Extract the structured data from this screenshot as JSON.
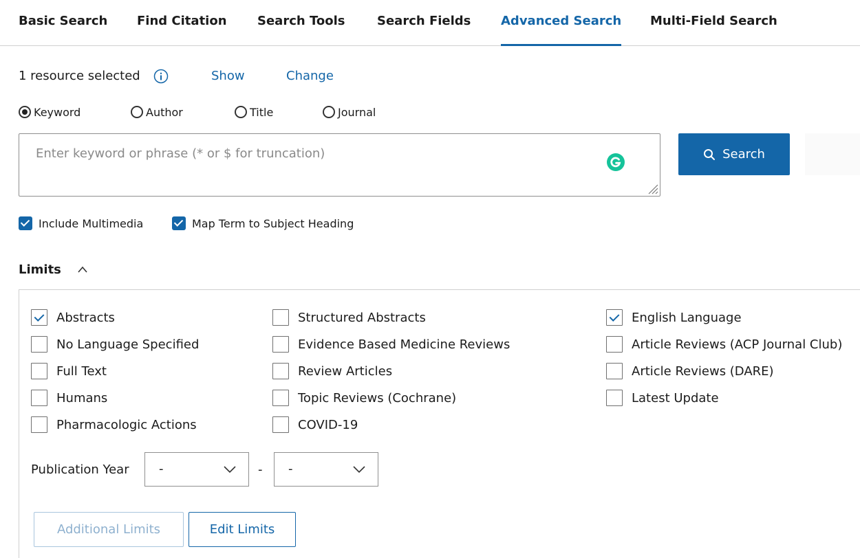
{
  "tabs": [
    {
      "label": "Basic Search",
      "active": false
    },
    {
      "label": "Find Citation",
      "active": false
    },
    {
      "label": "Search Tools",
      "active": false
    },
    {
      "label": "Search Fields",
      "active": false
    },
    {
      "label": "Advanced Search",
      "active": true
    },
    {
      "label": "Multi-Field Search",
      "active": false
    }
  ],
  "resources": {
    "selected_text": "1 resource selected",
    "show_link": "Show",
    "change_link": "Change"
  },
  "search_type": {
    "options": [
      "Keyword",
      "Author",
      "Title",
      "Journal"
    ],
    "selected": "Keyword"
  },
  "search": {
    "placeholder": "Enter keyword or phrase (* or $ for truncation)",
    "value": "",
    "button_label": "Search"
  },
  "options": {
    "include_multimedia": {
      "label": "Include Multimedia",
      "checked": true
    },
    "map_term": {
      "label": "Map Term to Subject Heading",
      "checked": true
    }
  },
  "limits": {
    "heading": "Limits",
    "columns": [
      [
        {
          "label": "Abstracts",
          "checked": true
        },
        {
          "label": "No Language Specified",
          "checked": false
        },
        {
          "label": "Full Text",
          "checked": false
        },
        {
          "label": "Humans",
          "checked": false
        },
        {
          "label": "Pharmacologic Actions",
          "checked": false
        }
      ],
      [
        {
          "label": "Structured Abstracts",
          "checked": false
        },
        {
          "label": "Evidence Based Medicine Reviews",
          "checked": false
        },
        {
          "label": "Review Articles",
          "checked": false
        },
        {
          "label": "Topic Reviews (Cochrane)",
          "checked": false
        },
        {
          "label": "COVID-19",
          "checked": false
        }
      ],
      [
        {
          "label": "English Language",
          "checked": true
        },
        {
          "label": "Article Reviews (ACP Journal Club)",
          "checked": false
        },
        {
          "label": "Article Reviews (DARE)",
          "checked": false
        },
        {
          "label": "Latest Update",
          "checked": false
        }
      ]
    ],
    "publication_year": {
      "label": "Publication Year",
      "from": "-",
      "separator": "-",
      "to": "-"
    },
    "additional_limits_label": "Additional Limits",
    "edit_limits_label": "Edit Limits"
  },
  "colors": {
    "accent": "#1466a8",
    "grammarly": "#15c39a"
  }
}
